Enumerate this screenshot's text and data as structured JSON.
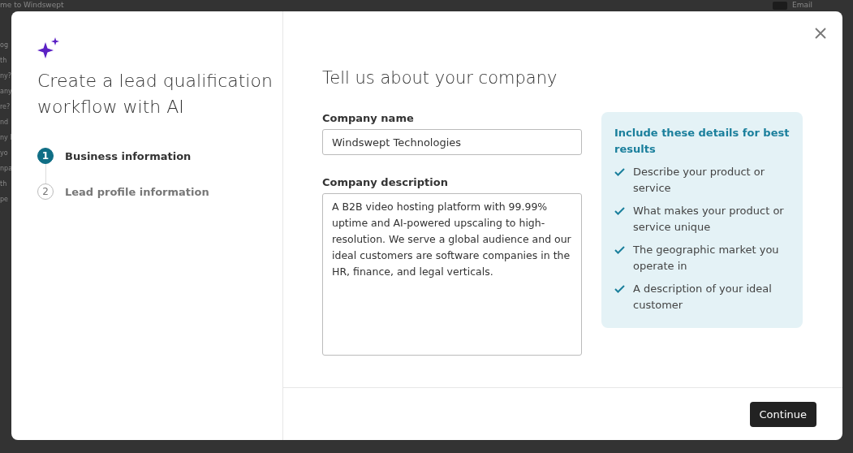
{
  "background": {
    "top_text": "me to Windswept",
    "side_fragments": [
      "og",
      "th",
      "ny?",
      "any",
      "re?",
      "nd",
      "ny l",
      "yo",
      "npa",
      "th",
      "pe"
    ],
    "top_right_label": "Email"
  },
  "dialog": {
    "title": "Create a lead qualification workflow with AI",
    "steps": [
      {
        "number": "1",
        "label": "Business information",
        "selected": true
      },
      {
        "number": "2",
        "label": "Lead profile information",
        "selected": false
      }
    ],
    "heading": "Tell us about your company",
    "fields": [
      {
        "kind": "input",
        "label": "Company name",
        "value": "Windswept Technologies"
      },
      {
        "kind": "textarea",
        "label": "Company description",
        "value": "A B2B video hosting platform with 99.99% uptime and AI-powered upscaling to high-resolution. We serve a global audience and our ideal customers are software companies in the HR, finance, and legal verticals."
      }
    ],
    "tips": {
      "title": "Include these details for best results",
      "items": [
        "Describe your product or service",
        "What makes your product or service unique",
        "The geographic market you operate in",
        "A description of your ideal customer"
      ]
    },
    "primary_button": "Continue"
  }
}
